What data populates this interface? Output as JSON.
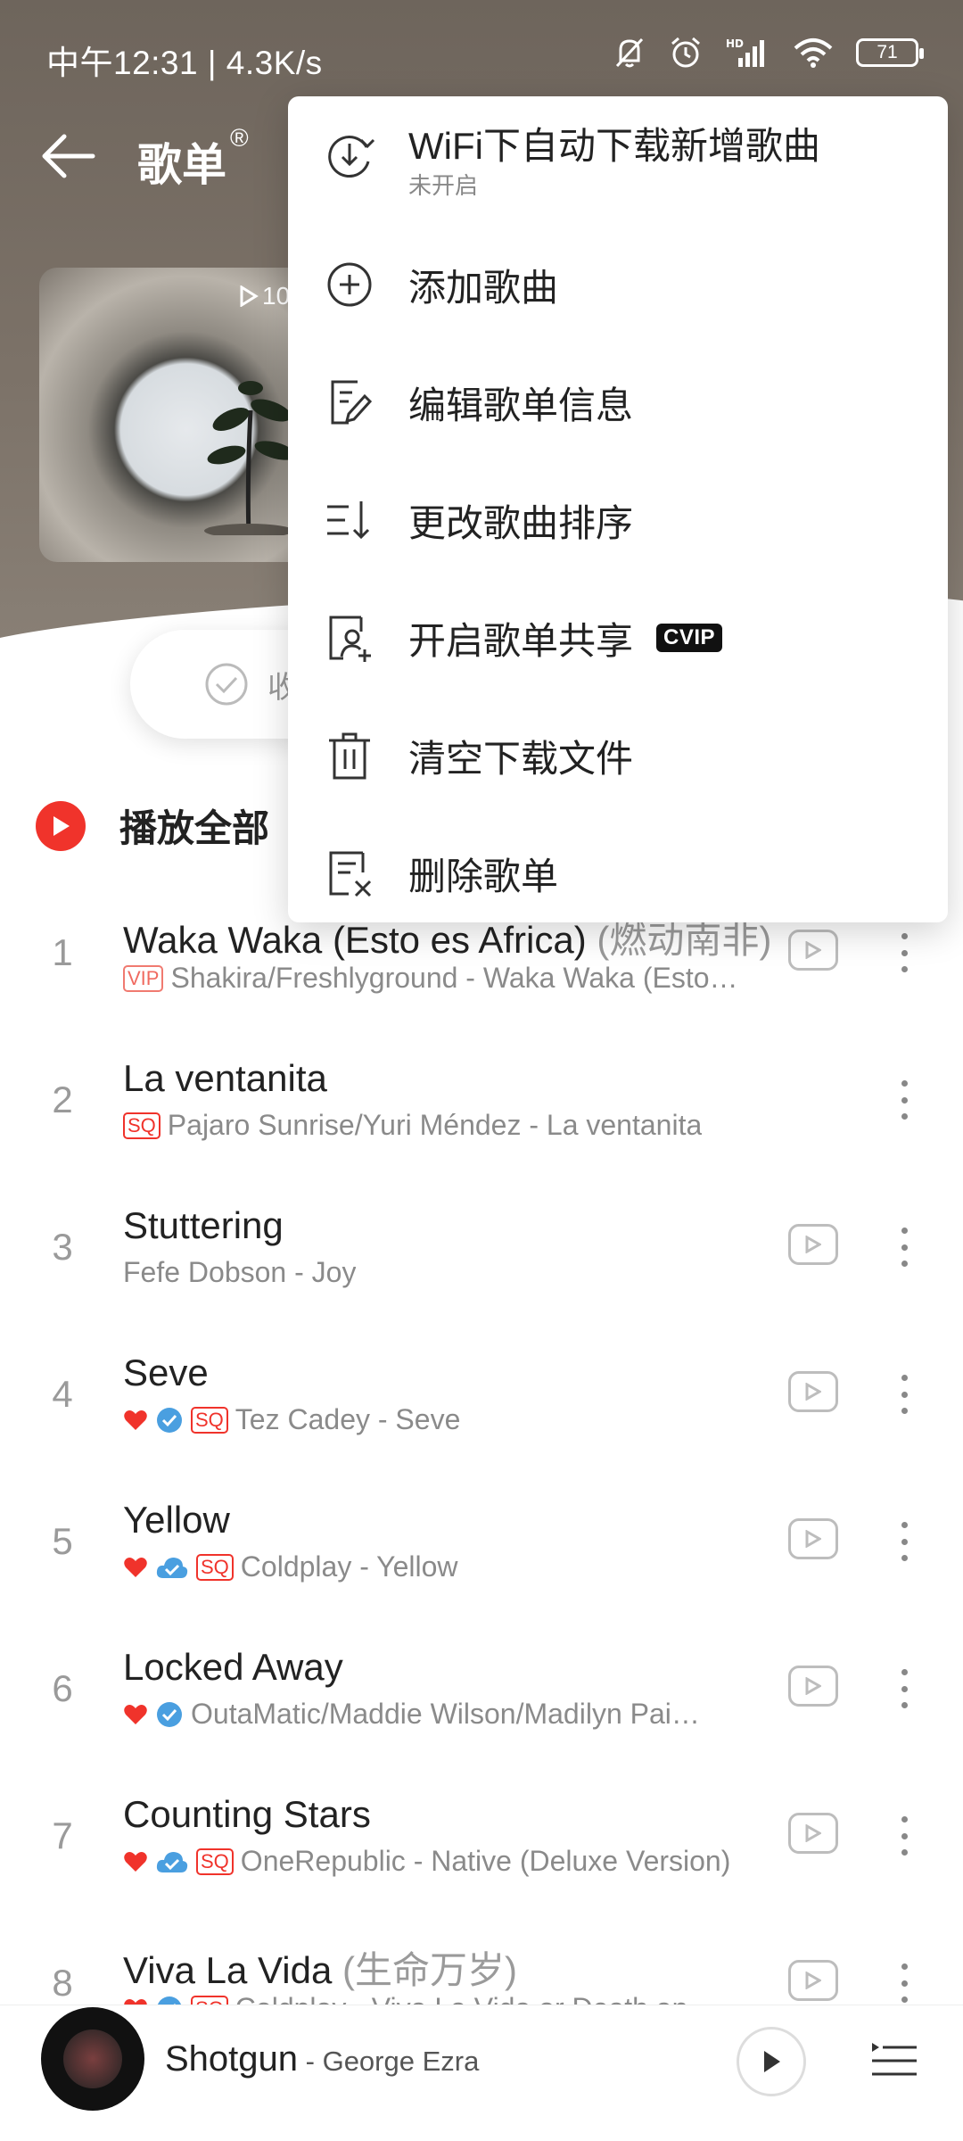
{
  "statusbar": {
    "time_speed": "中午12:31 | 4.3K/s",
    "battery": "71"
  },
  "header": {
    "title": "歌单",
    "title_mark": "®",
    "play_count": "10"
  },
  "collect": {
    "label": "收"
  },
  "play_all": {
    "label": "播放全部"
  },
  "menu": {
    "items": [
      {
        "label": "WiFi下自动下载新增歌曲",
        "sub": "未开启",
        "icon": "download-sync-icon"
      },
      {
        "label": "添加歌曲",
        "icon": "add-circle-icon"
      },
      {
        "label": "编辑歌单信息",
        "icon": "edit-doc-icon"
      },
      {
        "label": "更改歌曲排序",
        "icon": "sort-icon"
      },
      {
        "label": "开启歌单共享",
        "badge": "CVIP",
        "icon": "share-user-icon"
      },
      {
        "label": "清空下载文件",
        "icon": "trash-icon"
      },
      {
        "label": "删除歌单",
        "icon": "delete-list-icon"
      }
    ]
  },
  "songs": [
    {
      "num": "1",
      "title": "Waka Waka (Esto es Africa)",
      "sub": " (燃动南非)",
      "meta": "Shakira/Freshlyground - Waka Waka (Esto…",
      "tags": [
        "VIP"
      ],
      "heart": false,
      "cloud": false
    },
    {
      "num": "2",
      "title": "La ventanita",
      "sub": "",
      "meta": "Pajaro Sunrise/Yuri Méndez - La ventanita",
      "tags": [
        "SQ"
      ],
      "heart": false,
      "cloud": false
    },
    {
      "num": "3",
      "title": "Stuttering",
      "sub": "",
      "meta": "Fefe Dobson - Joy",
      "tags": [],
      "heart": false,
      "cloud": false
    },
    {
      "num": "4",
      "title": "Seve",
      "sub": "",
      "meta": "Tez Cadey - Seve",
      "tags": [
        "SQ"
      ],
      "heart": true,
      "cloud": true
    },
    {
      "num": "5",
      "title": "Yellow",
      "sub": "",
      "meta": "Coldplay - Yellow",
      "tags": [
        "SQ"
      ],
      "heart": true,
      "cloud": true
    },
    {
      "num": "6",
      "title": "Locked Away",
      "sub": "",
      "meta": "OutaMatic/Maddie Wilson/Madilyn Pai…",
      "tags": [],
      "heart": true,
      "cloud": true
    },
    {
      "num": "7",
      "title": "Counting Stars",
      "sub": "",
      "meta": "OneRepublic - Native (Deluxe Version)",
      "tags": [
        "SQ"
      ],
      "heart": true,
      "cloud": true
    },
    {
      "num": "8",
      "title": "Viva La Vida",
      "sub": " (生命万岁)",
      "meta": "Coldplay - Viva La Vida or Death an…",
      "tags": [
        "SQ"
      ],
      "heart": true,
      "cloud": true
    }
  ],
  "player": {
    "title": "Shotgun",
    "artist": " - George Ezra"
  },
  "colors": {
    "accent": "#f0332b",
    "header": "#766d63",
    "verified": "#4a9fe0"
  }
}
